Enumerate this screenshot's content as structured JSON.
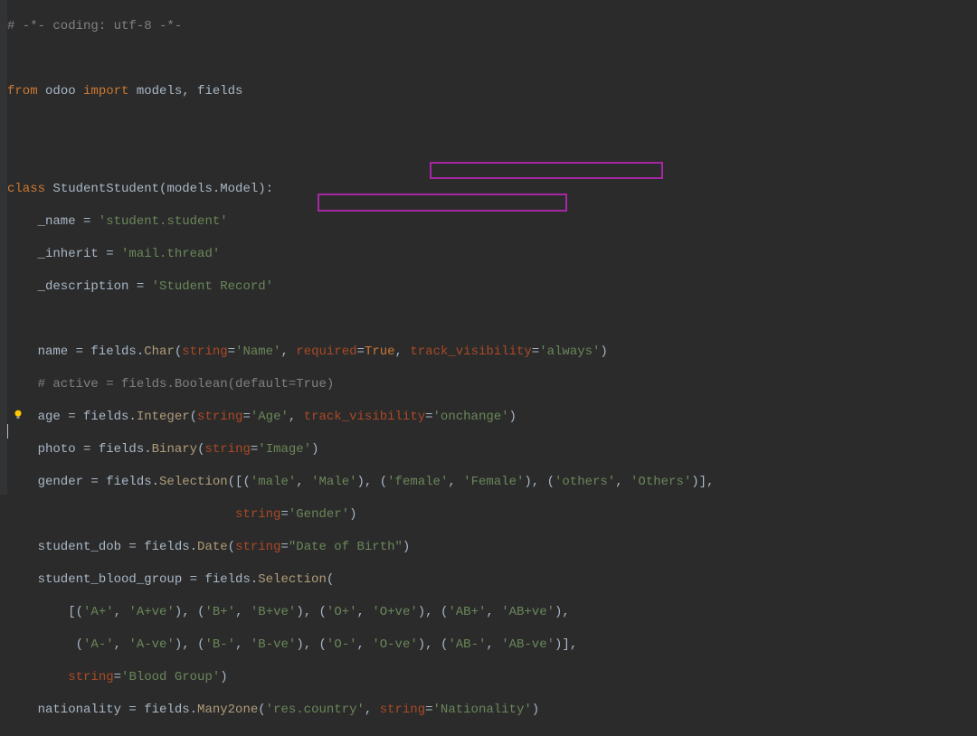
{
  "code": {
    "l1_comment": "# -*- coding: utf-8 -*-",
    "l2_from": "from ",
    "l2_pkg": "odoo ",
    "l2_import": "import ",
    "l2_mods": "models, fields",
    "l3_class_kw": "class ",
    "l3_class_name": "StudentStudent",
    "l3_class_args": "(models.Model):",
    "l4_nameattr": "    _name = ",
    "l4_nameval": "'student.student'",
    "l5_inherit": "    _inherit = ",
    "l5_inheritval": "'mail.thread'",
    "l6_desc": "    _description = ",
    "l6_descval": "'Student Record'",
    "l7_name": "    name = fields.",
    "l7_char": "Char",
    "l7_open": "(",
    "l7_strparam": "string",
    "l7_eq": "=",
    "l7_strval": "'Name'",
    "l7_c1": ", ",
    "l7_reqparam": "required",
    "l7_reqval": "True",
    "l7_c2": ", ",
    "l7_track": "track_visibility",
    "l7_trackval": "'always'",
    "l7_close": ")",
    "l8_comment": "    # active = fields.Boolean(default=True)",
    "l9_age": "    age = fields.",
    "l9_int": "Integer",
    "l9_open": "(",
    "l9_strparam": "string",
    "l9_strval": "'Age'",
    "l9_c1": ", ",
    "l9_track": "track_visibility",
    "l9_trackval": "'onchange'",
    "l9_close": ")",
    "l10_photo": "    photo = fields.",
    "l10_bin": "Binary",
    "l10_open": "(",
    "l10_strparam": "string",
    "l10_strval": "'Image'",
    "l10_close": ")",
    "l11_gender": "    gender = fields.",
    "l11_sel": "Selection",
    "l11_open": "([(",
    "l11_m1": "'male'",
    "l11_c": ", ",
    "l11_m2": "'Male'",
    "l11_c2": "), (",
    "l11_f1": "'female'",
    "l11_f2": "'Female'",
    "l11_c3": "), (",
    "l11_o1": "'others'",
    "l11_o2": "'Others'",
    "l11_close": ")],",
    "l12_indent": "                              ",
    "l12_strparam": "string",
    "l12_strval": "'Gender'",
    "l12_close": ")",
    "l13_dob": "    student_dob = fields.",
    "l13_date": "Date",
    "l13_open": "(",
    "l13_strparam": "string",
    "l13_strval": "\"Date of Birth\"",
    "l13_close": ")",
    "l14_bg": "    student_blood_group = fields.",
    "l14_sel": "Selection",
    "l14_open": "(",
    "l15_indent": "        [(",
    "l15_a1": "'A+'",
    "l15_a2": "'A+ve'",
    "l15_b1": "'B+'",
    "l15_b2": "'B+ve'",
    "l15_o1": "'O+'",
    "l15_o2": "'O+ve'",
    "l15_ab1": "'AB+'",
    "l15_ab2": "'AB+ve'",
    "l15_end": "),",
    "l16_indent": "         (",
    "l16_a1": "'A-'",
    "l16_a2": "'A-ve'",
    "l16_b1": "'B-'",
    "l16_b2": "'B-ve'",
    "l16_o1": "'O-'",
    "l16_o2": "'O-ve'",
    "l16_ab1": "'AB-'",
    "l16_ab2": "'AB-ve'",
    "l16_end": ")],",
    "l17_indent": "        ",
    "l17_strparam": "string",
    "l17_strval": "'Blood Group'",
    "l17_close": ")",
    "l18_nat": "    nationality = fields.",
    "l18_m2o": "Many2one",
    "l18_open": "(",
    "l18_res": "'res.country'",
    "l18_c": ", ",
    "l18_strparam": "string",
    "l18_strval": "'Nationality'",
    "l18_close": ")"
  }
}
